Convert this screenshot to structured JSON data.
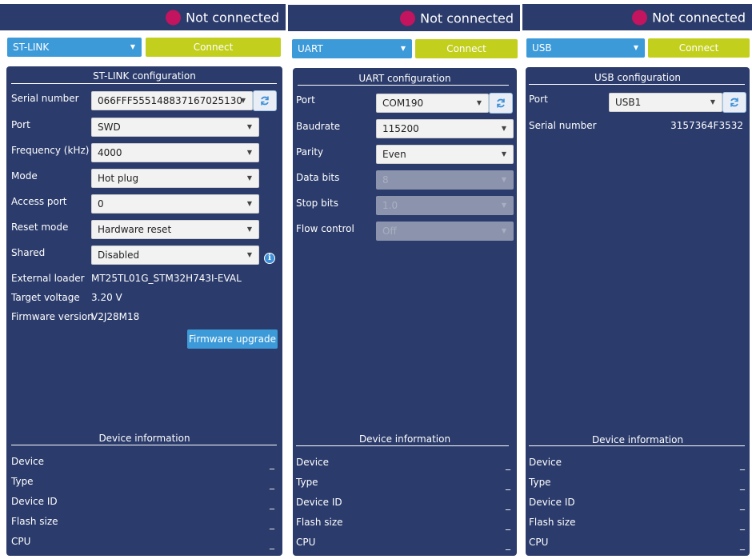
{
  "stlink": {
    "status": "Not connected",
    "interface": "ST-LINK",
    "connect_label": "Connect",
    "config_title": "ST-LINK configuration",
    "fields": {
      "serial_label": "Serial number",
      "serial_value": "066FFF555148837167025130",
      "port_label": "Port",
      "port_value": "SWD",
      "freq_label": "Frequency (kHz)",
      "freq_value": "4000",
      "mode_label": "Mode",
      "mode_value": "Hot plug",
      "ap_label": "Access port",
      "ap_value": "0",
      "reset_label": "Reset mode",
      "reset_value": "Hardware reset",
      "shared_label": "Shared",
      "shared_value": "Disabled",
      "loader_label": "External loader",
      "loader_value": "MT25TL01G_STM32H743I-EVAL",
      "voltage_label": "Target voltage",
      "voltage_value": "3.20 V",
      "fw_label": "Firmware version",
      "fw_value": "V2J28M18"
    },
    "fw_upgrade_label": "Firmware upgrade",
    "device_info_title": "Device information",
    "device_info": [
      {
        "label": "Device",
        "value": "_"
      },
      {
        "label": "Type",
        "value": "_"
      },
      {
        "label": "Device ID",
        "value": "_"
      },
      {
        "label": "Flash size",
        "value": "_"
      },
      {
        "label": "CPU",
        "value": "_"
      }
    ]
  },
  "uart": {
    "status": "Not connected",
    "interface": "UART",
    "connect_label": "Connect",
    "config_title": "UART configuration",
    "fields": {
      "port_label": "Port",
      "port_value": "COM190",
      "baud_label": "Baudrate",
      "baud_value": "115200",
      "parity_label": "Parity",
      "parity_value": "Even",
      "databits_label": "Data bits",
      "databits_value": "8",
      "stopbits_label": "Stop bits",
      "stopbits_value": "1.0",
      "flow_label": "Flow control",
      "flow_value": "Off"
    },
    "device_info_title": "Device information",
    "device_info": [
      {
        "label": "Device",
        "value": "_"
      },
      {
        "label": "Type",
        "value": "_"
      },
      {
        "label": "Device ID",
        "value": "_"
      },
      {
        "label": "Flash size",
        "value": "_"
      },
      {
        "label": "CPU",
        "value": "_"
      }
    ]
  },
  "usb": {
    "status": "Not connected",
    "interface": "USB",
    "connect_label": "Connect",
    "config_title": "USB configuration",
    "fields": {
      "port_label": "Port",
      "port_value": "USB1",
      "serial_label": "Serial number",
      "serial_value": "3157364F3532"
    },
    "device_info_title": "Device information",
    "device_info": [
      {
        "label": "Device",
        "value": "_"
      },
      {
        "label": "Type",
        "value": "_"
      },
      {
        "label": "Device ID",
        "value": "_"
      },
      {
        "label": "Flash size",
        "value": "_"
      },
      {
        "label": "CPU",
        "value": "_"
      }
    ]
  },
  "colors": {
    "panel_bg": "#2b3b6b",
    "accent_blue": "#3c9ad9",
    "connect_green": "#c3cf1d",
    "status_dot": "#c2145f"
  }
}
